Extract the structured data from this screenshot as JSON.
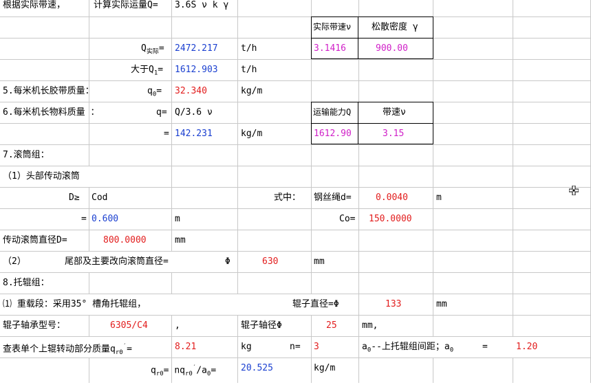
{
  "sheet": {
    "r1": {
      "a": "根据实际带速，",
      "b": "计算实际运量Q=",
      "c": "3.6S ν k γ"
    },
    "r2": {
      "h1": "实际带速ν",
      "h2": "松散密度 γ"
    },
    "r3": {
      "label_pre": "Q",
      "label_sub": "实际",
      "label_post": "=",
      "value": "2472.217",
      "unit": "t/h",
      "v1": "3.1416",
      "v2": "900.00"
    },
    "r4": {
      "label_pre": "大于Q",
      "label_sub": "1",
      "label_post": "=",
      "value": "1612.903",
      "unit": "t/h"
    },
    "r5": {
      "title": "5.每米机长胶带质量：",
      "label_pre": "q",
      "label_sub": "0",
      "label_post": "=",
      "value": "32.340",
      "unit": "kg/m"
    },
    "r6": {
      "title": "6.每米机长物料质量 ：",
      "label": "q=",
      "formula": "Q/3.6 ν",
      "h1": "运输能力Q",
      "h2": "带速ν"
    },
    "r7": {
      "label": "=",
      "value": "142.231",
      "unit": "kg/m",
      "v1": "1612.90",
      "v2": "3.15"
    },
    "r8": {
      "title": "7.滚筒组："
    },
    "r9": {
      "title": "（1）头部传动滚筒"
    },
    "r10": {
      "label": "D≥",
      "formula": "Cod",
      "where": "式中：",
      "wire_label": "钢丝绳d=",
      "wire_value": "0.0040",
      "wire_unit": "m"
    },
    "r11": {
      "label": "=",
      "value": "0.600",
      "unit": "m",
      "co_label": "Co=",
      "co_value": "150.0000"
    },
    "r12": {
      "label": "传动滚筒直径D=",
      "value": "800.0000",
      "unit": "mm"
    },
    "r13": {
      "a": "（2）",
      "b": "尾部及主要改向滚筒直径=",
      "phi": "Φ",
      "value": "630",
      "unit": "mm"
    },
    "r14": {
      "title": "8.托辊组："
    },
    "r15": {
      "title": "⑴ 重载段：采用35° 槽角托辊组，",
      "label": "辊子直径=Φ",
      "value": "133",
      "unit": "mm"
    },
    "r16": {
      "label": "辊子轴承型号：",
      "value": "6305/C4",
      "comma": ",",
      "axle_label": "辊子轴径Φ",
      "axle_value": "25",
      "axle_unit": "mm,"
    },
    "r17": {
      "label_pre": "查表单个上辊转动部分质量q",
      "label_sub": "r0",
      "label_sup": "′",
      "label_post": "=",
      "value": "8.21",
      "unit": "kg",
      "n_label": "n=",
      "n_value": "3",
      "a0_pre": "a",
      "a0_sub": "0",
      "a0_text": "--上托辊组间距；a",
      "a0_sub2": "0",
      "a0_eq": "=",
      "a0_value": "1.20"
    },
    "r18": {
      "label_pre": "q",
      "label_sub": "r0",
      "label_mid": "= nq",
      "label_sub2": "r0",
      "label_sup": "′",
      "label_post": "/a",
      "label_sub3": "0",
      "label_end": "=",
      "value": "20.525",
      "unit": "kg/m"
    }
  },
  "colors": {
    "red": "#e21d1d",
    "blue": "#1a3fd0",
    "magenta": "#d020c8",
    "grid": "#c8c8c8"
  },
  "icons": {
    "cursor": "move-cursor-icon"
  }
}
